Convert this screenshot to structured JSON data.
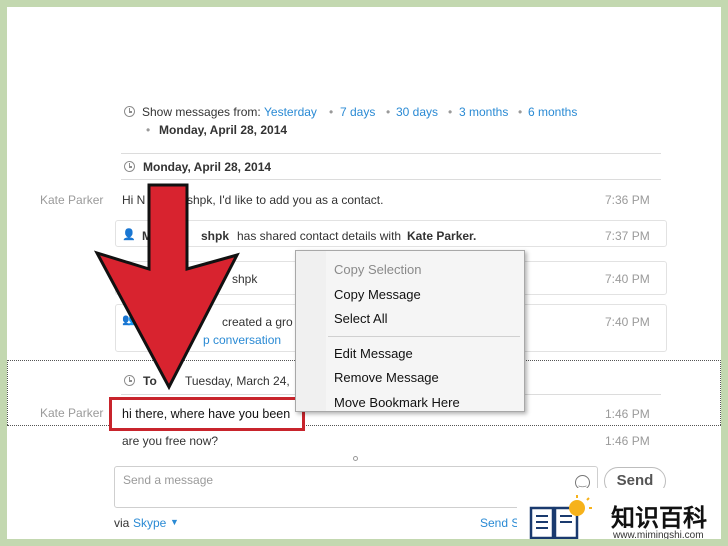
{
  "history": {
    "show_from_label": "Show messages from:",
    "ranges": [
      "Yesterday",
      "7 days",
      "30 days",
      "3 months",
      "6 months"
    ],
    "bullet_date": "Monday, April 28, 2014"
  },
  "day_header_1": "Monday, April 28, 2014",
  "messages": [
    {
      "sender": "Kate Parker",
      "text": "Hi N",
      "text2": "shpk, I'd like to add you as a contact.",
      "time": "7:36 PM"
    },
    {
      "sender": "",
      "text_a": "M",
      "text_b": "shpk",
      "text_c": "has shared contact details with",
      "text_d": "Kate Parker.",
      "time": "7:37 PM"
    },
    {
      "sender": "",
      "text": "shpk",
      "time": "7:40 PM"
    },
    {
      "sender": "",
      "text_a": "ker",
      "text_b": "created a gro",
      "text_c": "p conversation",
      "time": "7:40 PM"
    }
  ],
  "day_header_2": "Tuesday, March 24,",
  "day_header_2_prefix": "To",
  "today_messages": [
    {
      "sender": "Kate Parker",
      "text": "hi there, where have you been",
      "time": "1:46 PM"
    },
    {
      "sender": "",
      "text": "are you free now?",
      "time": "1:46 PM"
    }
  ],
  "context_menu": {
    "items": [
      {
        "label": "Copy Selection",
        "disabled": true
      },
      {
        "label": "Copy Message",
        "disabled": false
      },
      {
        "label": "Select All",
        "disabled": false
      },
      {
        "label": "Edit Message",
        "disabled": false
      },
      {
        "label": "Remove Message",
        "disabled": false
      },
      {
        "label": "Move Bookmark Here",
        "disabled": false
      }
    ]
  },
  "composer": {
    "placeholder": "Send a message",
    "send_label": "Send",
    "via_label": "via",
    "via_service": "Skype",
    "send_s_label": "Send S"
  },
  "watermark": {
    "title": "知识百科",
    "url": "www.mimingshi.com"
  },
  "colors": {
    "link": "#2a8ad4",
    "arrow_red": "#d8232f",
    "highlight_red": "#c8242c",
    "frame_green": "#c3d8b0"
  }
}
